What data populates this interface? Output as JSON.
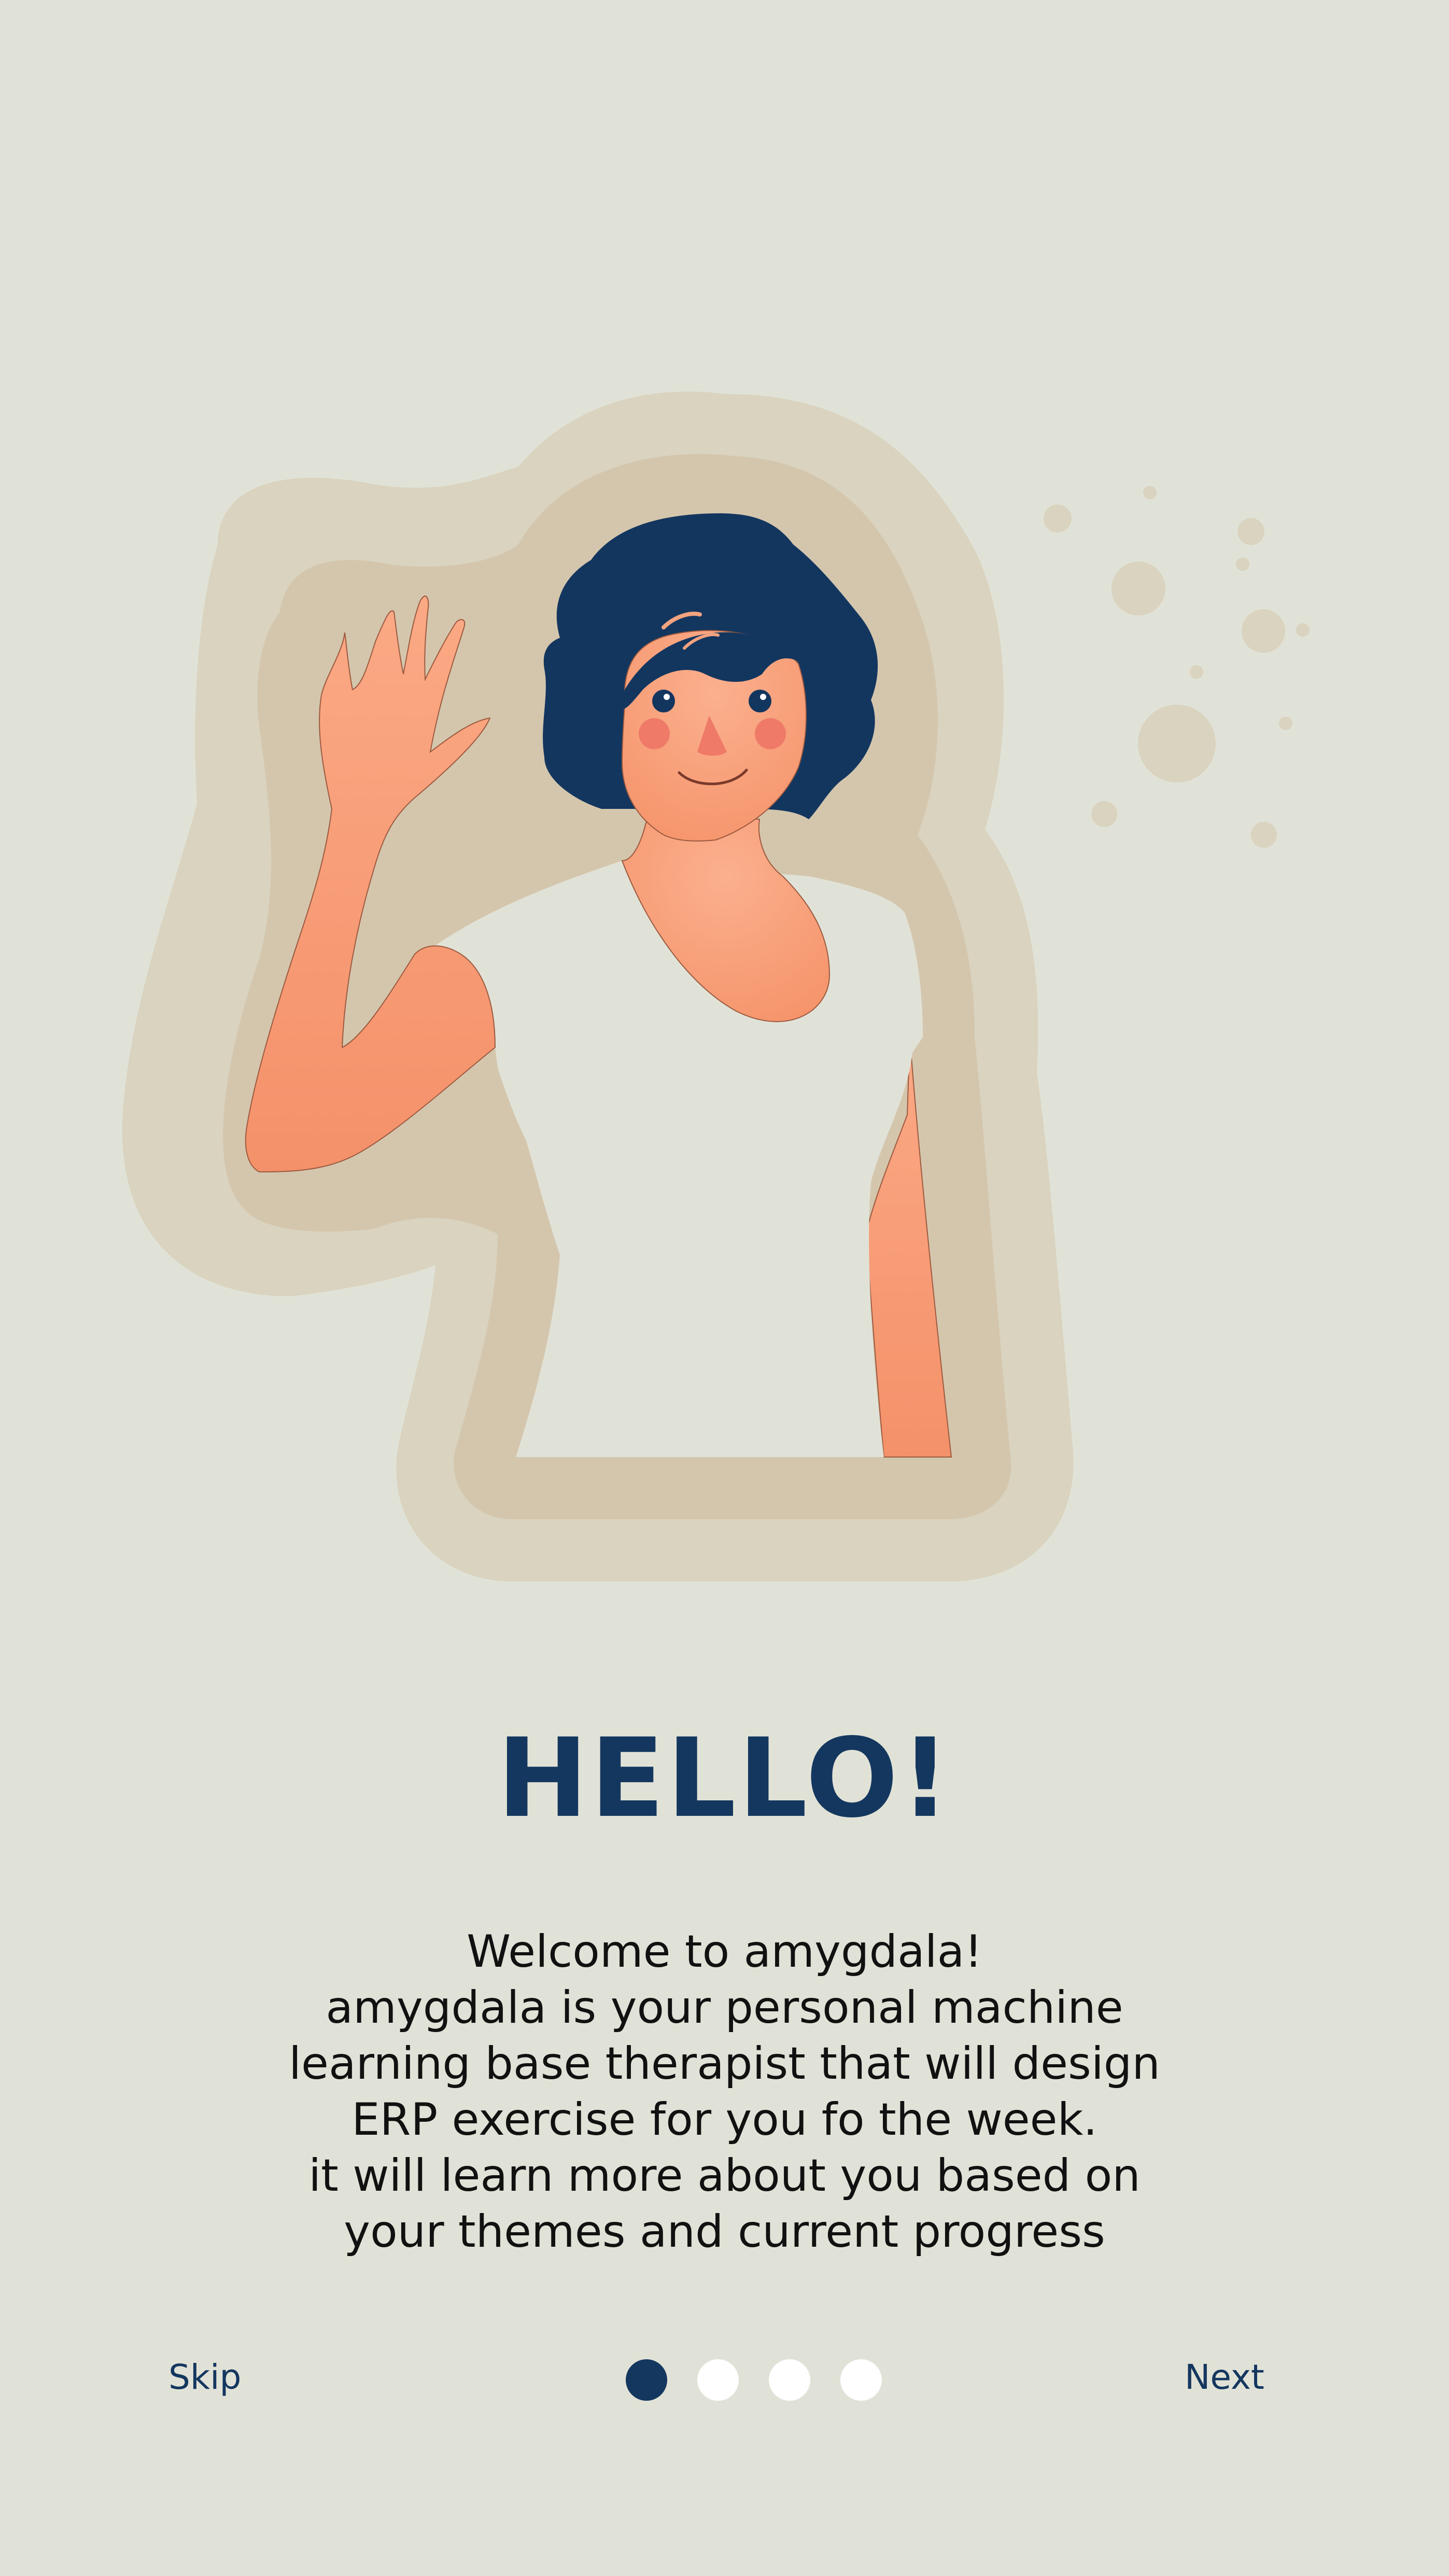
{
  "onboarding": {
    "title": "HELLO!",
    "description_lines": [
      "Welcome to amygdala!",
      "amygdala is your personal machine",
      "learning base therapist that will design",
      "ERP exercise for you fo the week.",
      "it will learn more about you based on",
      "your themes and current progress"
    ],
    "skip_label": "Skip",
    "next_label": "Next",
    "pagination": {
      "current_page": 1,
      "total_pages": 4
    }
  },
  "colors": {
    "background": "#e1e2d7",
    "primary": "#14375f",
    "text": "#111111",
    "dot_inactive": "#ffffff"
  }
}
